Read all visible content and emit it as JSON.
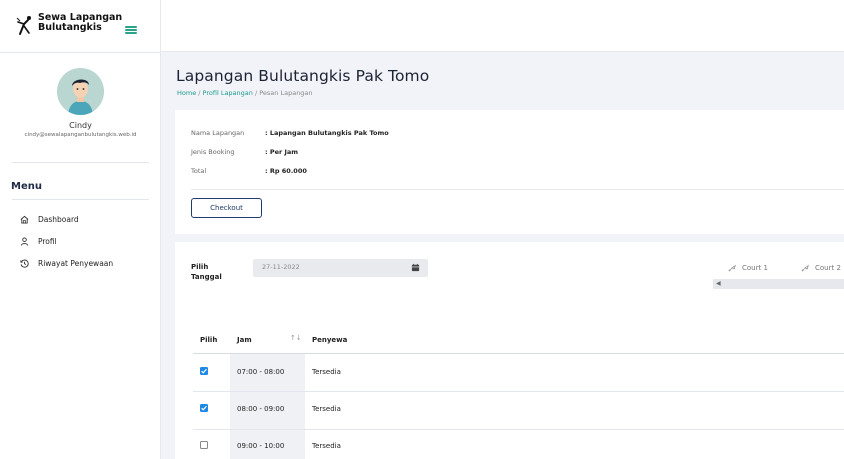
{
  "brand": {
    "line1": "Sewa Lapangan",
    "line2": "Bulutangkis"
  },
  "user": {
    "name": "Cindy",
    "email": "cindy@sewalapanganbulutangkis.web.id"
  },
  "menu": {
    "title": "Menu",
    "items": [
      {
        "label": "Dashboard",
        "icon": "home-icon"
      },
      {
        "label": "Profil",
        "icon": "user-icon"
      },
      {
        "label": "Riwayat Penyewaan",
        "icon": "history-icon"
      }
    ]
  },
  "page": {
    "title": "Lapangan Bulutangkis Pak Tomo",
    "breadcrumb": [
      "Home",
      "Profil Lapangan",
      "Pesan Lapangan"
    ]
  },
  "booking": {
    "fields": [
      {
        "label": "Nama Lapangan",
        "value": ": Lapangan Bulutangkis Pak Tomo"
      },
      {
        "label": "Jenis Booking",
        "value": ": Per Jam"
      },
      {
        "label": "Total",
        "value": ": Rp 60.000"
      }
    ],
    "checkout_label": "Checkout"
  },
  "schedule": {
    "date_label_line1": "Pilih",
    "date_label_line2": "Tanggal",
    "date_value": "27-11-2022",
    "courts": [
      "Court 1",
      "Court 2"
    ],
    "columns": {
      "pilih": "Pilih",
      "jam": "Jam",
      "penyewa": "Penyewa"
    },
    "rows": [
      {
        "checked": true,
        "jam": "07:00 - 08:00",
        "penyewa": "Tersedia"
      },
      {
        "checked": true,
        "jam": "08:00 - 09:00",
        "penyewa": "Tersedia"
      },
      {
        "checked": false,
        "jam": "09:00 - 10:00",
        "penyewa": "Tersedia"
      }
    ]
  },
  "colors": {
    "accent": "#1a9a8a",
    "primary": "#1f3b6e",
    "checkbox": "#1e88e5"
  }
}
